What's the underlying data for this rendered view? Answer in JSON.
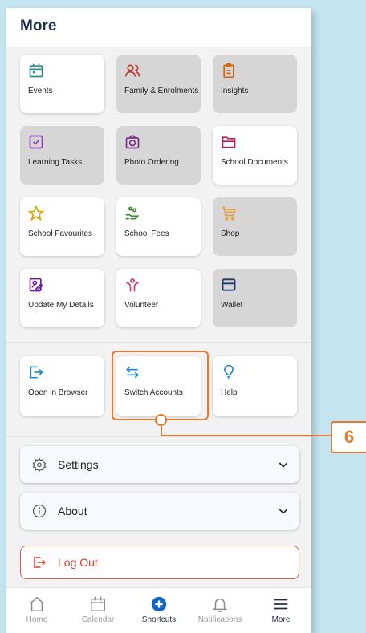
{
  "header": {
    "title": "More"
  },
  "grid": [
    {
      "label": "Events",
      "icon": "calendar-icon",
      "enabled": true
    },
    {
      "label": "Family & Enrolments",
      "icon": "people-icon",
      "enabled": false
    },
    {
      "label": "Insights",
      "icon": "clipboard-icon",
      "enabled": false
    },
    {
      "label": "Learning Tasks",
      "icon": "checkbox-icon",
      "enabled": false
    },
    {
      "label": "Photo Ordering",
      "icon": "camera-icon",
      "enabled": false
    },
    {
      "label": "School Documents",
      "icon": "folder-icon",
      "enabled": true
    },
    {
      "label": "School Favourites",
      "icon": "star-icon",
      "enabled": true
    },
    {
      "label": "School Fees",
      "icon": "hand-coins-icon",
      "enabled": true
    },
    {
      "label": "Shop",
      "icon": "cart-icon",
      "enabled": false
    },
    {
      "label": "Update My Details",
      "icon": "edit-profile-icon",
      "enabled": true
    },
    {
      "label": "Volunteer",
      "icon": "volunteer-icon",
      "enabled": true
    },
    {
      "label": "Wallet",
      "icon": "wallet-icon",
      "enabled": false
    }
  ],
  "actions": [
    {
      "label": "Open in Browser",
      "icon": "open-external-icon"
    },
    {
      "label": "Switch Accounts",
      "icon": "switch-arrows-icon"
    },
    {
      "label": "Help",
      "icon": "lightbulb-icon"
    }
  ],
  "settings": {
    "label": "Settings"
  },
  "about": {
    "label": "About"
  },
  "logout": {
    "label": "Log Out"
  },
  "nav": [
    {
      "label": "Home",
      "icon": "home-icon"
    },
    {
      "label": "Calendar",
      "icon": "calendar-icon"
    },
    {
      "label": "Shortcuts",
      "icon": "plus-circle-icon"
    },
    {
      "label": "Notifications",
      "icon": "bell-icon"
    },
    {
      "label": "More",
      "icon": "menu-icon"
    }
  ],
  "callout": {
    "number": "6"
  },
  "colors": {
    "title": "#1f2d4d",
    "highlight": "#e8782b",
    "logout": "#d7392c",
    "disabled_tile": "#d6d6d6",
    "background": "#c4e4ef"
  }
}
